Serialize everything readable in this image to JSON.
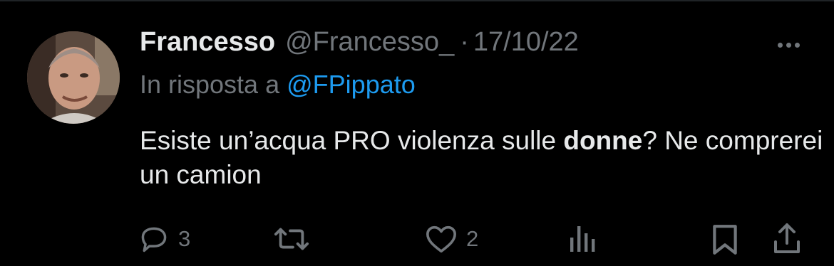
{
  "tweet": {
    "author_name": "Francesso",
    "handle": "@Francesso_",
    "separator": "·",
    "date": "17/10/22",
    "reply_prefix": "In risposta a",
    "reply_to": "@FPippato",
    "text_part1": "Esiste un’acqua PRO violenza sulle ",
    "text_bold": "donne",
    "text_part2": "? Ne comprerei un camion"
  },
  "actions": {
    "reply_count": "3",
    "retweet_count": "",
    "like_count": "2"
  },
  "icons": {
    "avatar": "user-avatar-photo",
    "more": "more-options-icon",
    "reply": "reply-bubble-icon",
    "retweet": "retweet-icon",
    "like": "heart-icon",
    "views": "analytics-bars-icon",
    "bookmark": "bookmark-icon",
    "share": "share-icon"
  },
  "colors": {
    "background": "#000000",
    "text": "#e7e9ea",
    "secondary": "#71767b",
    "link": "#1d9bf0"
  }
}
